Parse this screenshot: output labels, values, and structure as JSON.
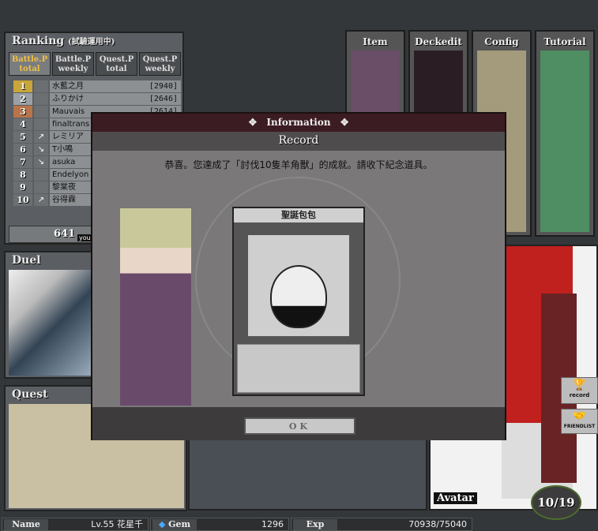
{
  "ranking": {
    "title": "Ranking",
    "subtitle": "(試驗運用中)",
    "tabs": [
      {
        "label": "Battle.P total"
      },
      {
        "label": "Battle.P weekly"
      },
      {
        "label": "Quest.P total"
      },
      {
        "label": "Quest.P weekly"
      }
    ],
    "rows": [
      {
        "rank": "1",
        "arrow": "",
        "name": "水藍之月",
        "score": "[2940]"
      },
      {
        "rank": "2",
        "arrow": "",
        "name": "ふりかけ",
        "score": "[2646]"
      },
      {
        "rank": "3",
        "arrow": "",
        "name": "Mauvais",
        "score": "[2614]"
      },
      {
        "rank": "4",
        "arrow": "",
        "name": "finaltrans",
        "score": ""
      },
      {
        "rank": "5",
        "arrow": "↗",
        "name": "レミリア",
        "score": ""
      },
      {
        "rank": "6",
        "arrow": "↘",
        "name": "T小鳴",
        "score": ""
      },
      {
        "rank": "7",
        "arrow": "↘",
        "name": "asuka",
        "score": ""
      },
      {
        "rank": "8",
        "arrow": "",
        "name": "Endelyon",
        "score": ""
      },
      {
        "rank": "9",
        "arrow": "",
        "name": "黎棠夜",
        "score": ""
      },
      {
        "rank": "10",
        "arrow": "↗",
        "name": "谷得霖",
        "score": ""
      }
    ],
    "your_rank": "641",
    "your_label": "your"
  },
  "duel": {
    "title": "Duel"
  },
  "quest": {
    "title": "Quest"
  },
  "menu": [
    {
      "label": "Item"
    },
    {
      "label": "Deckedit"
    },
    {
      "label": "Config"
    },
    {
      "label": "Tutorial"
    }
  ],
  "avatar": {
    "title": "Avatar",
    "record_label": "record",
    "friendlist_label": "FRIENDLIST",
    "count": "10/19"
  },
  "dialog": {
    "header": "Information",
    "title": "Record",
    "message": "恭喜。您達成了「討伐10隻羊角獸」的成就。請收下紀念道具。",
    "item_name": "聖誕包包",
    "ok_label": "OK"
  },
  "status": {
    "name_label": "Name",
    "name_value": "Lv.55 花星千",
    "gem_label": "Gem",
    "gem_value": "1296",
    "exp_label": "Exp",
    "exp_value": "70938/75040"
  }
}
